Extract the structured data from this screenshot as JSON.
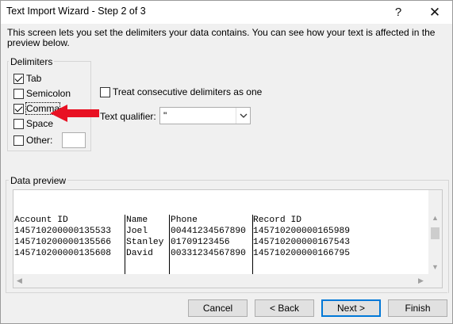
{
  "window": {
    "title": "Text Import Wizard - Step 2 of 3",
    "help_glyph": "?",
    "close_glyph": "✕"
  },
  "description": "This screen lets you set the delimiters your data contains.  You can see how your text is affected in the preview below.",
  "delimiters": {
    "label": "Delimiters",
    "items": [
      {
        "label": "Tab",
        "checked": true
      },
      {
        "label": "Semicolon",
        "checked": false
      },
      {
        "label": "Comma",
        "checked": true
      },
      {
        "label": "Space",
        "checked": false
      },
      {
        "label": "Other:",
        "checked": false
      }
    ],
    "other_value": ""
  },
  "consecutive": {
    "label": "Treat consecutive delimiters as one",
    "checked": false
  },
  "text_qualifier": {
    "label": "Text qualifier:",
    "value": "\""
  },
  "preview": {
    "label": "Data preview",
    "columns": [
      {
        "header": "Account ID",
        "cells": [
          "145710200000135533",
          "145710200000135566",
          "145710200000135608"
        ]
      },
      {
        "header": "Name",
        "cells": [
          "Joel",
          "Stanley",
          "David"
        ]
      },
      {
        "header": "Phone",
        "cells": [
          "00441234567890",
          "01709123456",
          "00331234567890"
        ]
      },
      {
        "header": "Record ID",
        "cells": [
          "145710200000165989",
          "145710200000167543",
          "145710200000166795"
        ]
      }
    ]
  },
  "buttons": {
    "cancel": "Cancel",
    "back": "< Back",
    "next": "Next >",
    "finish": "Finish"
  },
  "colors": {
    "annotation_arrow": "#e81123",
    "accent": "#0078d7"
  }
}
